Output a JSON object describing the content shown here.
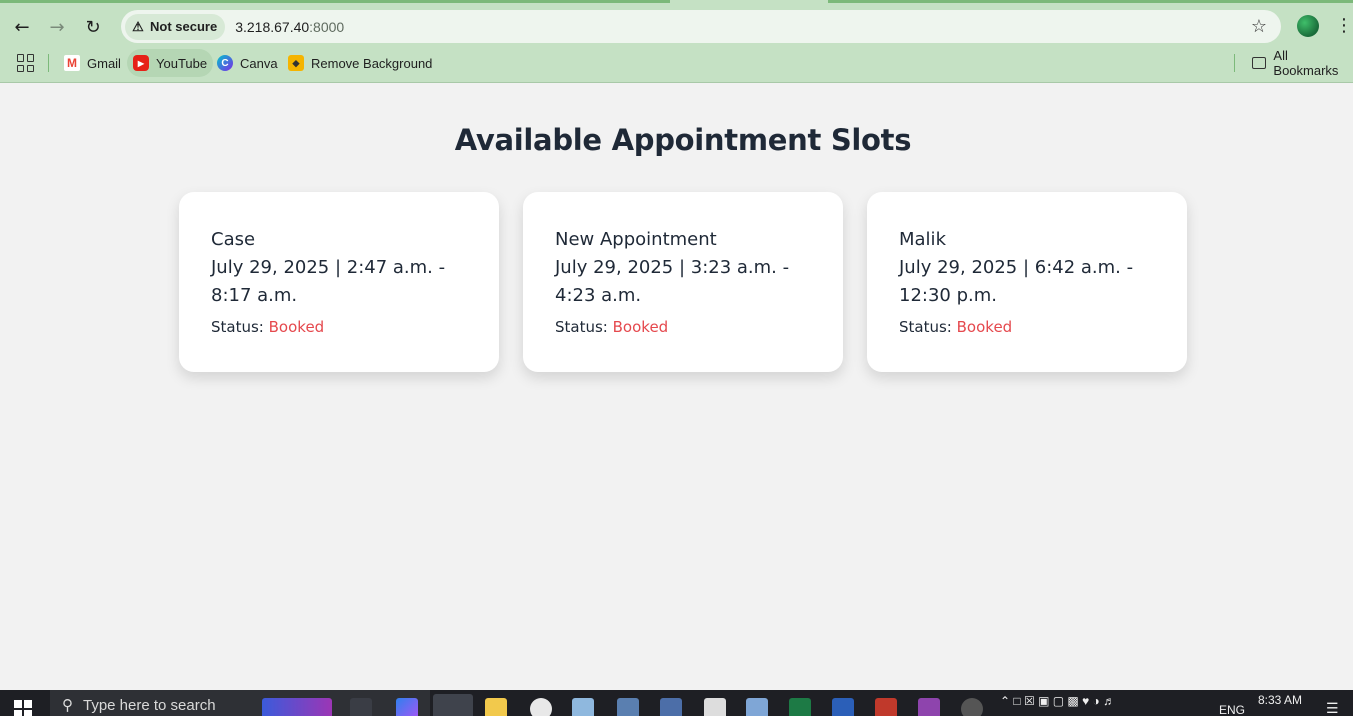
{
  "browser": {
    "security_label": "Not secure",
    "url_host": "3.218.67.40",
    "url_port": ":8000",
    "bookmarks": [
      {
        "label": "Gmail",
        "icon": "gmail-icon"
      },
      {
        "label": "YouTube",
        "icon": "youtube-icon"
      },
      {
        "label": "Canva",
        "icon": "canva-icon"
      },
      {
        "label": "Remove Background",
        "icon": "remove-background-icon"
      }
    ],
    "all_bookmarks_label": "All Bookmarks"
  },
  "page": {
    "title": "Available Appointment Slots",
    "slots": [
      {
        "name": "Case",
        "time": "July 29, 2025 | 2:47 a.m. - 8:17 a.m.",
        "status_label": "Status:",
        "status": "Booked"
      },
      {
        "name": "New Appointment",
        "time": "July 29, 2025 | 3:23 a.m. - 4:23 a.m.",
        "status_label": "Status:",
        "status": "Booked"
      },
      {
        "name": "Malik",
        "time": "July 29, 2025 | 6:42 a.m. - 12:30 p.m.",
        "status_label": "Status:",
        "status": "Booked"
      }
    ],
    "status_color": "#e5484d"
  },
  "taskbar": {
    "search_placeholder": "Type here to search",
    "language": "ENG",
    "time": "8:33 AM"
  }
}
